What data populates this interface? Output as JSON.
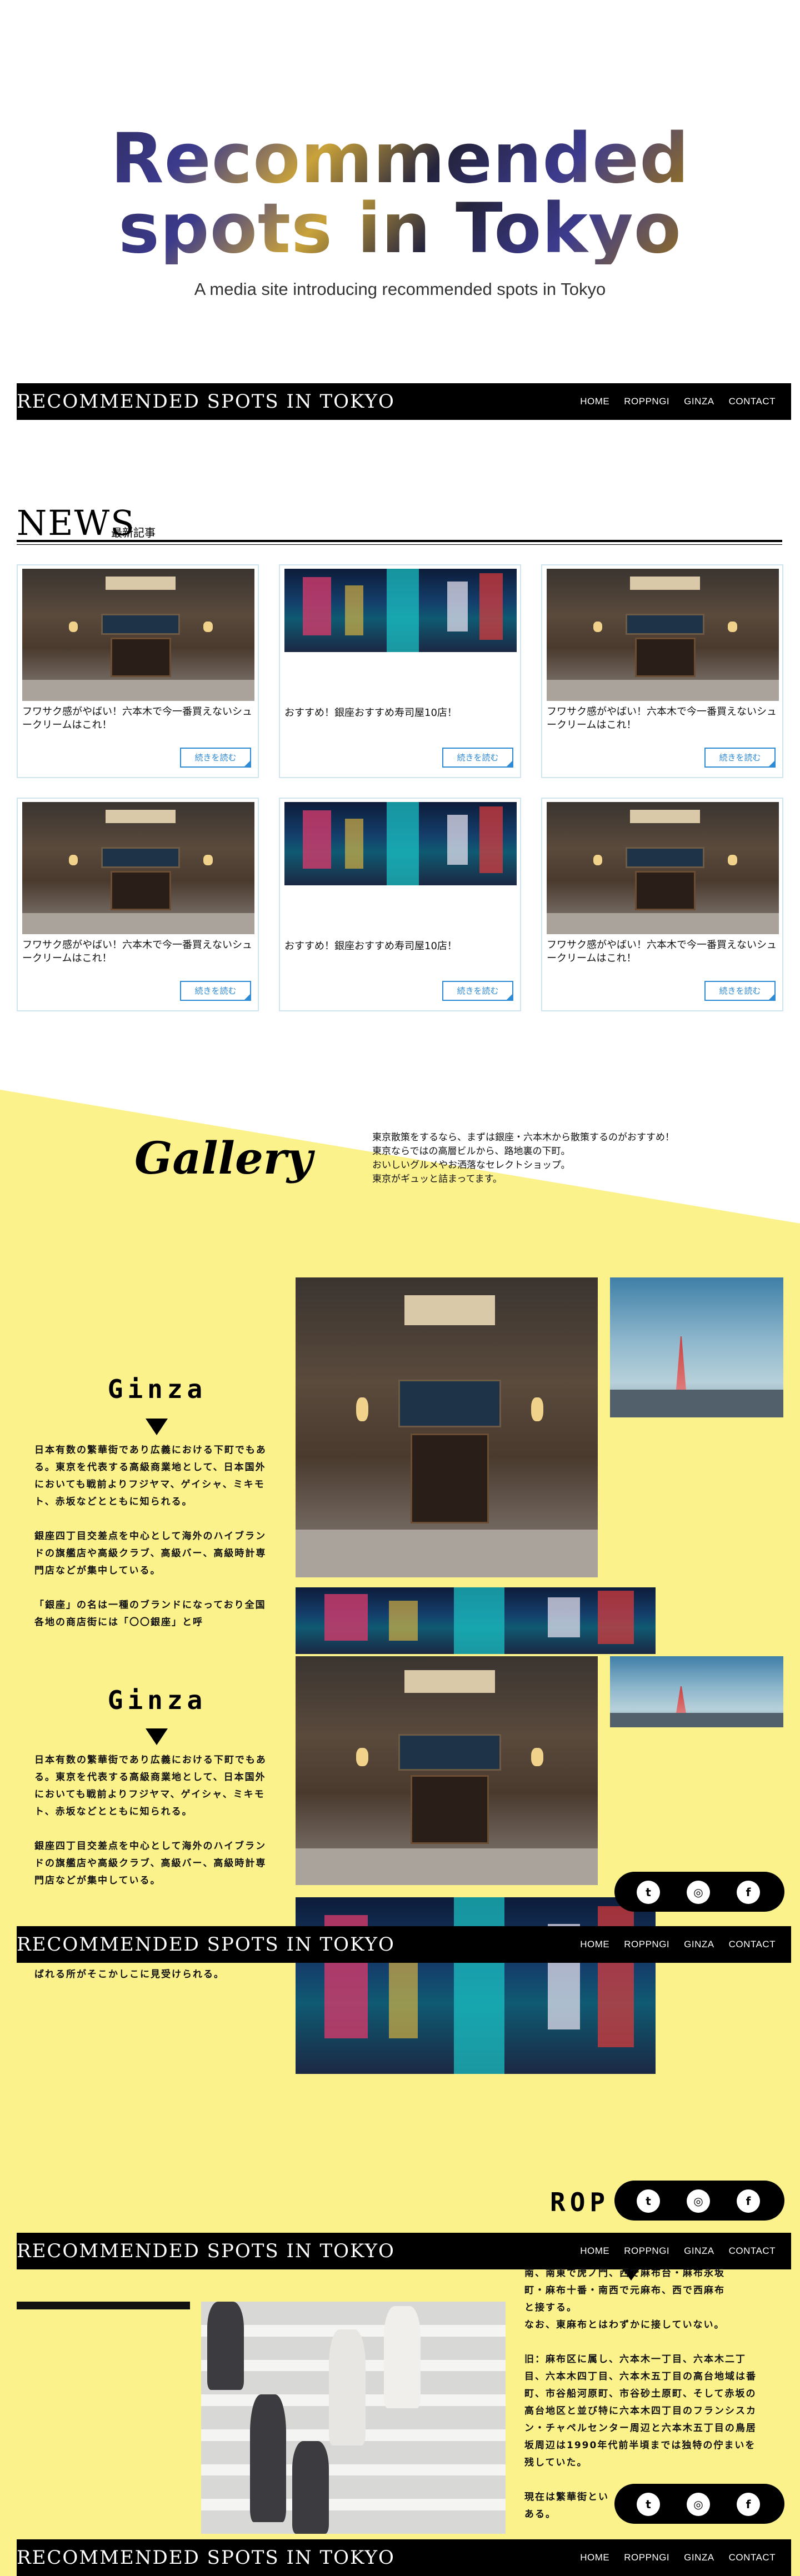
{
  "hero": {
    "title_line1": "Recommended",
    "title_line2": "spots in Tokyo",
    "subtitle": "A media site introducing recommended spots in Tokyo"
  },
  "header": {
    "brand": "RECOMMENDED SPOTS IN TOKYO",
    "nav": [
      "HOME",
      "ROPPNGI",
      "GINZA",
      "CONTACT"
    ]
  },
  "news": {
    "title": "NEWS",
    "subtitle": "最新記事",
    "read_more": "続きを読む",
    "cards": [
      {
        "title": "フワサク感がやばい！六本木で今一番買えないシュークリームはこれ！",
        "image": "shop-photo"
      },
      {
        "title": "おすすめ！銀座おすすめ寿司屋10店！",
        "image": "neon-street-photo"
      },
      {
        "title": "フワサク感がやばい！六本木で今一番買えないシュークリームはこれ！",
        "image": "shop-photo"
      },
      {
        "title": "フワサク感がやばい！六本木で今一番買えないシュークリームはこれ！",
        "image": "shop-photo"
      },
      {
        "title": "おすすめ！銀座おすすめ寿司屋10店！",
        "image": "neon-street-photo"
      },
      {
        "title": "フワサク感がやばい！六本木で今一番買えないシュークリームはこれ！",
        "image": "shop-photo"
      }
    ]
  },
  "gallery": {
    "title": "Gallery",
    "lines": [
      "東京散策をするなら、まずは銀座・六本木から散策するのがおすすめ！",
      "東京ならではの高層ビルから、路地裏の下町。",
      "おいしいグルメやお洒落なセレクトショップ。",
      "東京がギュッと詰まってます。"
    ]
  },
  "ginza": {
    "title": "Ginza",
    "p1": "日本有数の繁華街であり広義における下町でもある。東京を代表する高級商業地として、日本国外においても戦前よりフジヤマ、ゲイシャ、ミキモト、赤坂などとともに知られる。",
    "p2": "銀座四丁目交差点を中心として海外のハイブランドの旗艦店や高級クラブ、高級バー、高級時計専門店などが集中している。",
    "p3": "「銀座」の名は一種のブランドになっており全国各地の商店街には「〇〇銀座」と呼",
    "p3_end": "ばれる所がそこかしこに見受けられる。"
  },
  "roppongi": {
    "title": "ROP",
    "p0a": "南、南東で虎ノ門、西で麻布台・麻布永坂",
    "p0b": "町・麻布十番・南西で元麻布、西で西麻布",
    "p0c": "と接する。",
    "p0d": "なお、東麻布とはわずかに接していない。",
    "p1": "旧：麻布区に属し、六本木一丁目、六本木二丁目、六本木四丁目、六本木五丁目の高台地域は番町、市谷船河原町、市谷砂土原町、そして赤坂の高台地区と並び特に六本木四丁目のフランシスカン・チャペルセンター周辺と六本木五丁目の鳥居坂周辺は1990年代前半頃までは独特の佇まいを残していた。",
    "p2": "現在は繁華街とい",
    "p2_end": "ある。"
  },
  "social": {
    "twitter": "twitter-icon",
    "instagram": "instagram-icon",
    "facebook": "facebook-icon"
  },
  "colors": {
    "accent_blue": "#2f8bd6",
    "yellow_bg": "#fcf28c",
    "bar_bg": "#000000"
  }
}
